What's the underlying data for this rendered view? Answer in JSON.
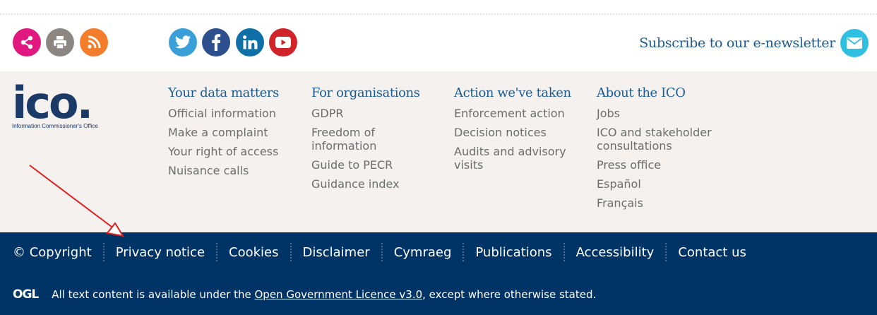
{
  "share_icons": [
    {
      "name": "share-icon",
      "color": "#e0187f"
    },
    {
      "name": "print-icon",
      "color": "#8c8682"
    },
    {
      "name": "rss-icon",
      "color": "#f37d2b"
    }
  ],
  "social_icons": [
    {
      "name": "twitter-icon",
      "color": "#3a9fd9"
    },
    {
      "name": "facebook-icon",
      "color": "#2d4f8d"
    },
    {
      "name": "linkedin-icon",
      "color": "#0f6fa7"
    },
    {
      "name": "youtube-icon",
      "color": "#d1232a"
    }
  ],
  "subscribe": {
    "label": "Subscribe to our e-newsletter",
    "icon": "envelope-icon",
    "color": "#2fbfe0"
  },
  "logo": {
    "mark": "ico.",
    "subtitle": "Information Commissioner's Office"
  },
  "nav": [
    {
      "heading": "Your data matters",
      "links": [
        "Official information",
        "Make a complaint",
        "Your right of access",
        "Nuisance calls"
      ]
    },
    {
      "heading": "For organisations",
      "links": [
        "GDPR",
        "Freedom of information",
        "Guide to PECR",
        "Guidance index"
      ]
    },
    {
      "heading": "Action we've taken",
      "links": [
        "Enforcement action",
        "Decision notices",
        "Audits and advisory visits"
      ]
    },
    {
      "heading": "About the ICO",
      "links": [
        "Jobs",
        "ICO and stakeholder consultations",
        "Press office",
        "Español",
        "Français"
      ]
    }
  ],
  "footer": {
    "links": [
      "© Copyright",
      "Privacy notice",
      "Cookies",
      "Disclaimer",
      "Cymraeg",
      "Publications",
      "Accessibility",
      "Contact us"
    ],
    "ogl_logo": "OGL",
    "licence_prefix": "All text content is available under the ",
    "licence_link": "Open Government Licence v3.0",
    "licence_suffix": ", except where otherwise stated."
  },
  "colors": {
    "brand_navy": "#003366",
    "heading_blue": "#1d5b91",
    "annotation_arrow": "#e02020"
  }
}
